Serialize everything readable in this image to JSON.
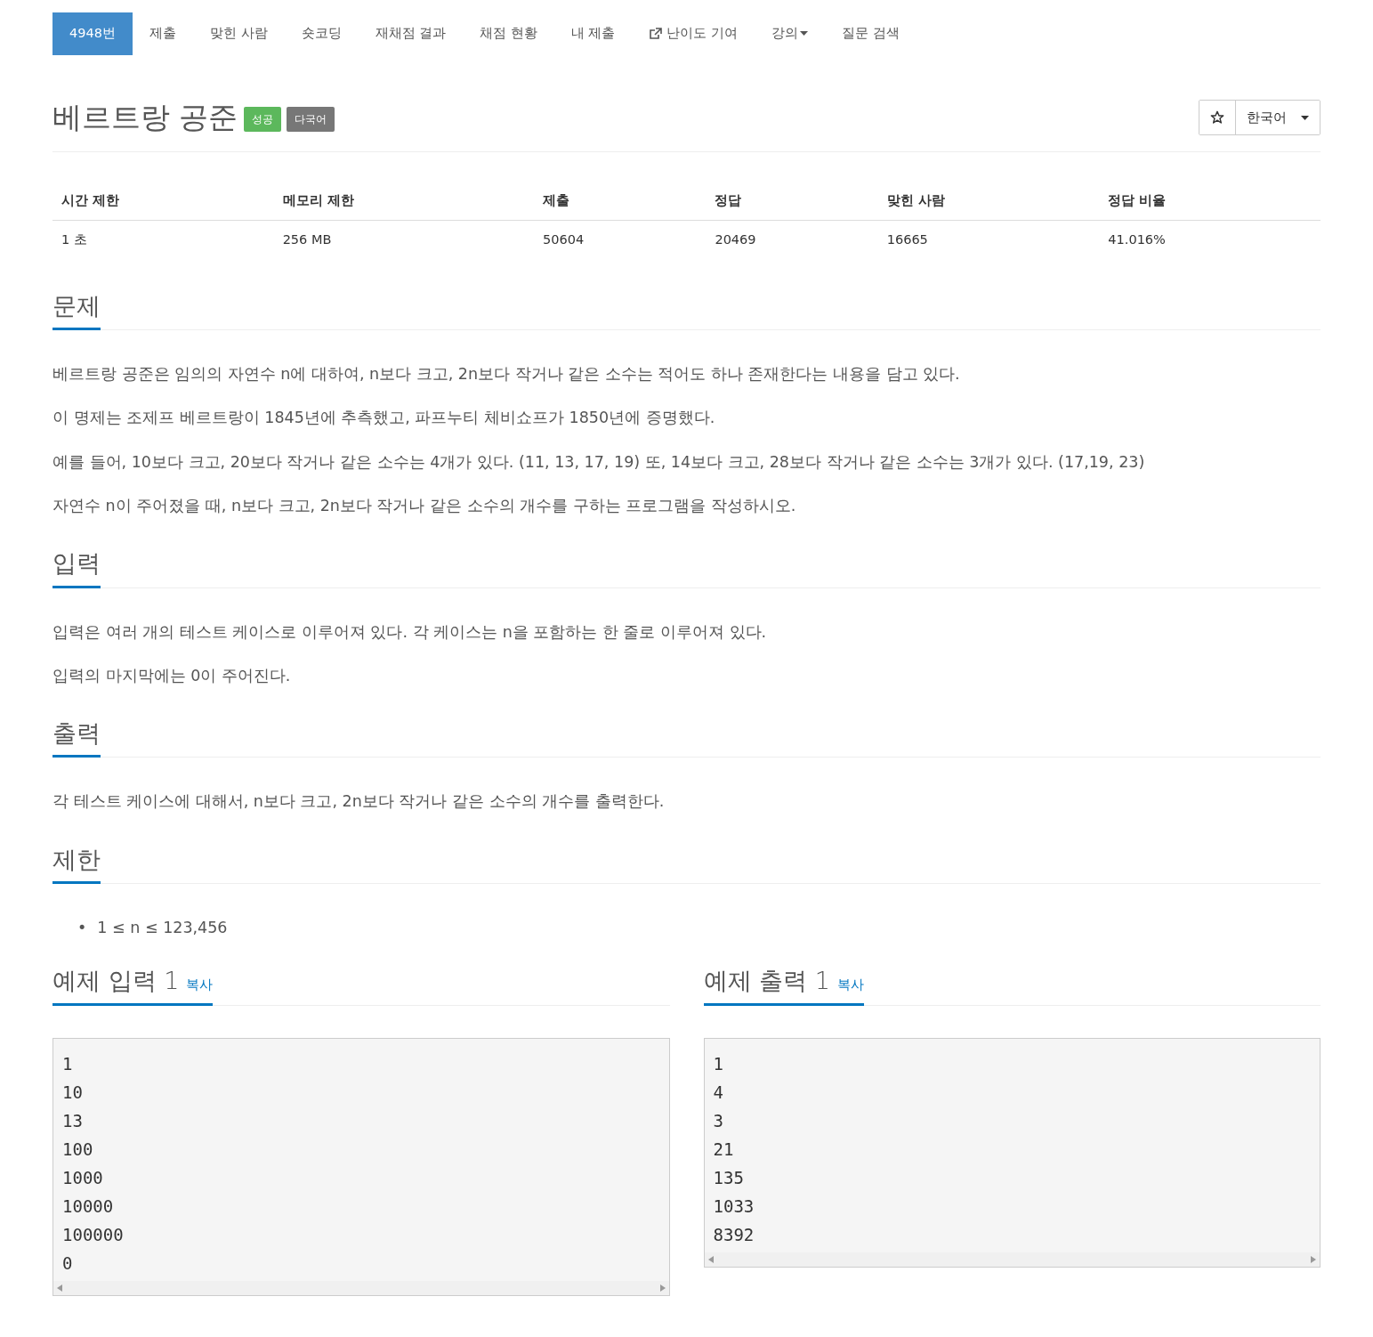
{
  "nav": [
    {
      "label": "4948번",
      "selected": true
    },
    {
      "label": "제출",
      "selected": false
    },
    {
      "label": "맞힌 사람",
      "selected": false
    },
    {
      "label": "숏코딩",
      "selected": false
    },
    {
      "label": "재채점 결과",
      "selected": false
    },
    {
      "label": "채점 현황",
      "selected": false
    },
    {
      "label": "내 제출",
      "selected": false
    },
    {
      "label": "난이도 기여",
      "selected": false,
      "kind": "external"
    },
    {
      "label": "강의",
      "selected": false,
      "kind": "dropdown"
    },
    {
      "label": "질문 검색",
      "selected": false
    }
  ],
  "title": "베르트랑 공준",
  "labels": [
    {
      "text": "성공",
      "color": "#5cb85c"
    },
    {
      "text": "다국어",
      "color": "#777777"
    }
  ],
  "language_button": "한국어",
  "info_table": {
    "columns": [
      "시간 제한",
      "메모리 제한",
      "제출",
      "정답",
      "맞힌 사람",
      "정답 비율"
    ],
    "rows": [
      [
        "1 초",
        "256 MB",
        "50604",
        "20469",
        "16665",
        "41.016%"
      ]
    ]
  },
  "sections": [
    {
      "heading": "문제",
      "paragraphs": [
        "베르트랑 공준은 임의의 자연수 n에 대하여, n보다 크고, 2n보다 작거나 같은 소수는 적어도 하나 존재한다는 내용을 담고 있다.",
        "이 명제는 조제프 베르트랑이 1845년에 추측했고, 파프누티 체비쇼프가 1850년에 증명했다.",
        "예를 들어, 10보다 크고, 20보다 작거나 같은 소수는 4개가 있다. (11, 13, 17, 19) 또, 14보다 크고, 28보다 작거나 같은 소수는 3개가 있다. (17,19, 23)",
        "자연수 n이 주어졌을 때, n보다 크고, 2n보다 작거나 같은 소수의 개수를 구하는 프로그램을 작성하시오."
      ]
    },
    {
      "heading": "입력",
      "paragraphs": [
        "입력은 여러 개의 테스트 케이스로 이루어져 있다. 각 케이스는 n을 포함하는 한 줄로 이루어져 있다.",
        "입력의 마지막에는 0이 주어진다."
      ]
    },
    {
      "heading": "출력",
      "paragraphs": [
        "각 테스트 케이스에 대해서, n보다 크고, 2n보다 작거나 같은 소수의 개수를 출력한다."
      ]
    },
    {
      "heading": "제한",
      "bullets": [
        {
          "marker": "•",
          "text": "1 ≤ n ≤ 123,456"
        }
      ]
    }
  ],
  "samples": [
    {
      "heading": "예제 입력 1",
      "copy": "복사",
      "lines": [
        "1",
        "10",
        "13",
        "100",
        "1000",
        "10000",
        "100000",
        "0"
      ]
    },
    {
      "heading": "예제 출력 1",
      "copy": "복사",
      "lines": [
        "1",
        "4",
        "3",
        "21",
        "135",
        "1033",
        "8392"
      ]
    }
  ]
}
